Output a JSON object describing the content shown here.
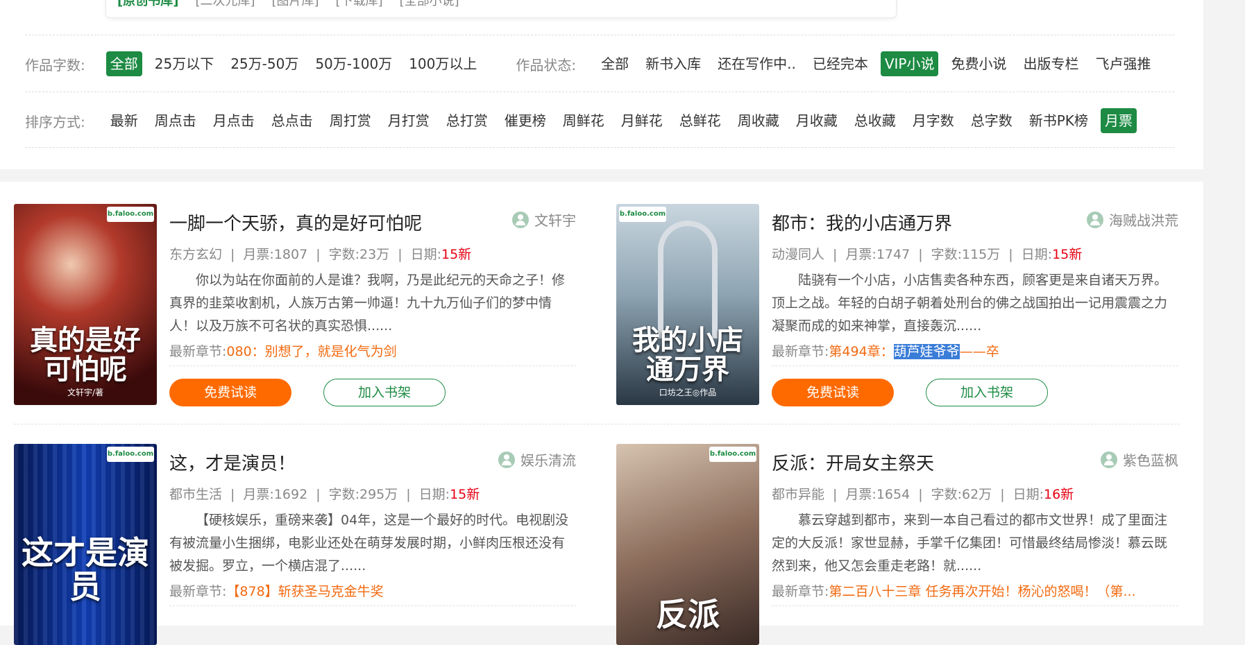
{
  "top_tabs": [
    "[原创书库]",
    "[二次元库]",
    "[图片库]",
    "[下载库]",
    "[全部小说]"
  ],
  "word_count": {
    "label": "作品字数:",
    "options": [
      "全部",
      "25万以下",
      "25万-50万",
      "50万-100万",
      "100万以上"
    ],
    "selected": "全部"
  },
  "status": {
    "label": "作品状态:",
    "options": [
      "全部",
      "新书入库",
      "还在写作中..",
      "已经完本",
      "VIP小说",
      "免费小说",
      "出版专栏",
      "飞卢强推"
    ],
    "selected": "VIP小说"
  },
  "sort": {
    "label": "排序方式:",
    "options": [
      "最新",
      "周点击",
      "月点击",
      "总点击",
      "周打赏",
      "月打赏",
      "总打赏",
      "催更榜",
      "周鲜花",
      "月鲜花",
      "总鲜花",
      "周收藏",
      "月收藏",
      "总收藏",
      "月字数",
      "总字数",
      "新书PK榜",
      "月票"
    ],
    "selected": "月票"
  },
  "labels": {
    "monthly": "月票:",
    "words": "字数:",
    "date": "日期:",
    "latest": "最新章节:",
    "read_button": "免费试读",
    "shelf_button": "加入书架",
    "sep": "|"
  },
  "books": [
    {
      "title": "一脚一个天骄，真的是好可怕呢",
      "author": "文轩宇",
      "category": "东方玄幻",
      "monthly_votes": "1807",
      "words": "23万",
      "date": "15新",
      "description": "你以为站在你面前的人是谁？我啊，乃是此纪元的天命之子！修真界的韭菜收割机，人族万古第一帅逼！九十九万仙子们的梦中情人！以及万族不可名状的真实恐惧......",
      "latest_chapter": "080：别想了，就是化气为剑",
      "latest_highlight": "",
      "latest_tail": "",
      "cover_text": "真的是好可怕呢",
      "cover_sub": "文轩宇/著"
    },
    {
      "title": "都市：我的小店通万界",
      "author": "海贼战洪荒",
      "category": "动漫同人",
      "monthly_votes": "1747",
      "words": "115万",
      "date": "15新",
      "description": "陆骁有一个小店，小店售卖各种东西，顾客更是来自诸天万界。顶上之战。年轻的白胡子朝着处刑台的佛之战国拍出一记用震震之力凝聚而成的如来神掌，直接轰沉......",
      "latest_chapter": "第494章：",
      "latest_highlight": "葫芦娃爷爷",
      "latest_tail": "——卒",
      "cover_text": "我的小店通万界",
      "cover_sub": "口坊之王◎作品"
    },
    {
      "title": "这，才是演员！",
      "author": "娱乐清流",
      "category": "都市生活",
      "monthly_votes": "1692",
      "words": "295万",
      "date": "15新",
      "description": "【硬核娱乐，重磅来袭】04年，这是一个最好的时代。电视剧没有被流量小生捆绑，电影业还处在萌芽发展时期，小鲜肉压根还没有被发掘。罗立，一个横店混了......",
      "latest_chapter": "【878】斩获圣马克金牛奖",
      "latest_highlight": "",
      "latest_tail": "",
      "cover_text": "这才是演员",
      "cover_sub": ""
    },
    {
      "title": "反派：开局女主祭天",
      "author": "紫色蓝枫",
      "category": "都市异能",
      "monthly_votes": "1654",
      "words": "62万",
      "date": "16新",
      "description": "慕云穿越到都市，来到一本自己看过的都市文世界！成了里面注定的大反派！家世显赫，手掌千亿集团！可惜最终结局惨淡！慕云既然到来，他又怎会重走老路！就......",
      "latest_chapter": "第二百八十三章 任务再次开始！杨沁的怒喝！（第...",
      "latest_highlight": "",
      "latest_tail": "",
      "cover_text": "反派",
      "cover_sub": ""
    }
  ]
}
